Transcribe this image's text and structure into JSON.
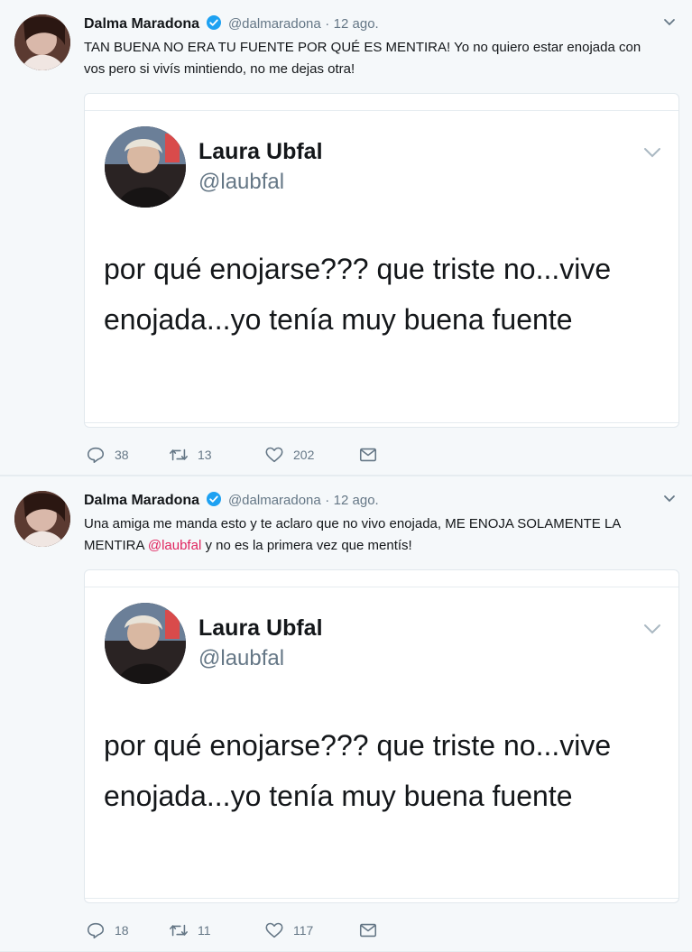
{
  "tweets": [
    {
      "author": {
        "name": "Dalma Maradona",
        "handle": "@dalmaradona",
        "verified": true
      },
      "separator": "·",
      "date": "12 ago.",
      "text": "TAN BUENA NO ERA TU FUENTE POR QUÉ ES MENTIRA! Yo no quiero estar enojada con vos pero si vivís mintiendo, no me dejas otra!",
      "quote": {
        "name": "Laura Ubfal",
        "handle": "@laubfal",
        "text": "por qué enojarse??? que triste no...vive enojada...yo tenía muy buena fuente"
      },
      "actions": {
        "replies": "38",
        "retweets": "13",
        "likes": "202"
      }
    },
    {
      "author": {
        "name": "Dalma Maradona",
        "handle": "@dalmaradona",
        "verified": true
      },
      "separator": "·",
      "date": "12 ago.",
      "text_before_mention": "Una amiga me manda esto y te aclaro que no vivo enojada, ME ENOJA SOLAMENTE LA MENTIRA ",
      "mention": "@laubfal",
      "text_after_mention": " y no es la primera vez que mentís!",
      "quote": {
        "name": "Laura Ubfal",
        "handle": "@laubfal",
        "text": "por qué enojarse??? que triste no...vive enojada...yo tenía muy buena fuente"
      },
      "actions": {
        "replies": "18",
        "retweets": "11",
        "likes": "117"
      }
    }
  ],
  "colors": {
    "background": "#f5f8fa",
    "card": "#ffffff",
    "text": "#14171a",
    "secondary": "#657786",
    "verified": "#1da1f2",
    "mention": "#e0245e"
  },
  "icons": [
    "avatar",
    "verified-badge-icon",
    "chevron-down-icon",
    "reply-icon",
    "retweet-icon",
    "like-icon",
    "direct-message-icon"
  ]
}
